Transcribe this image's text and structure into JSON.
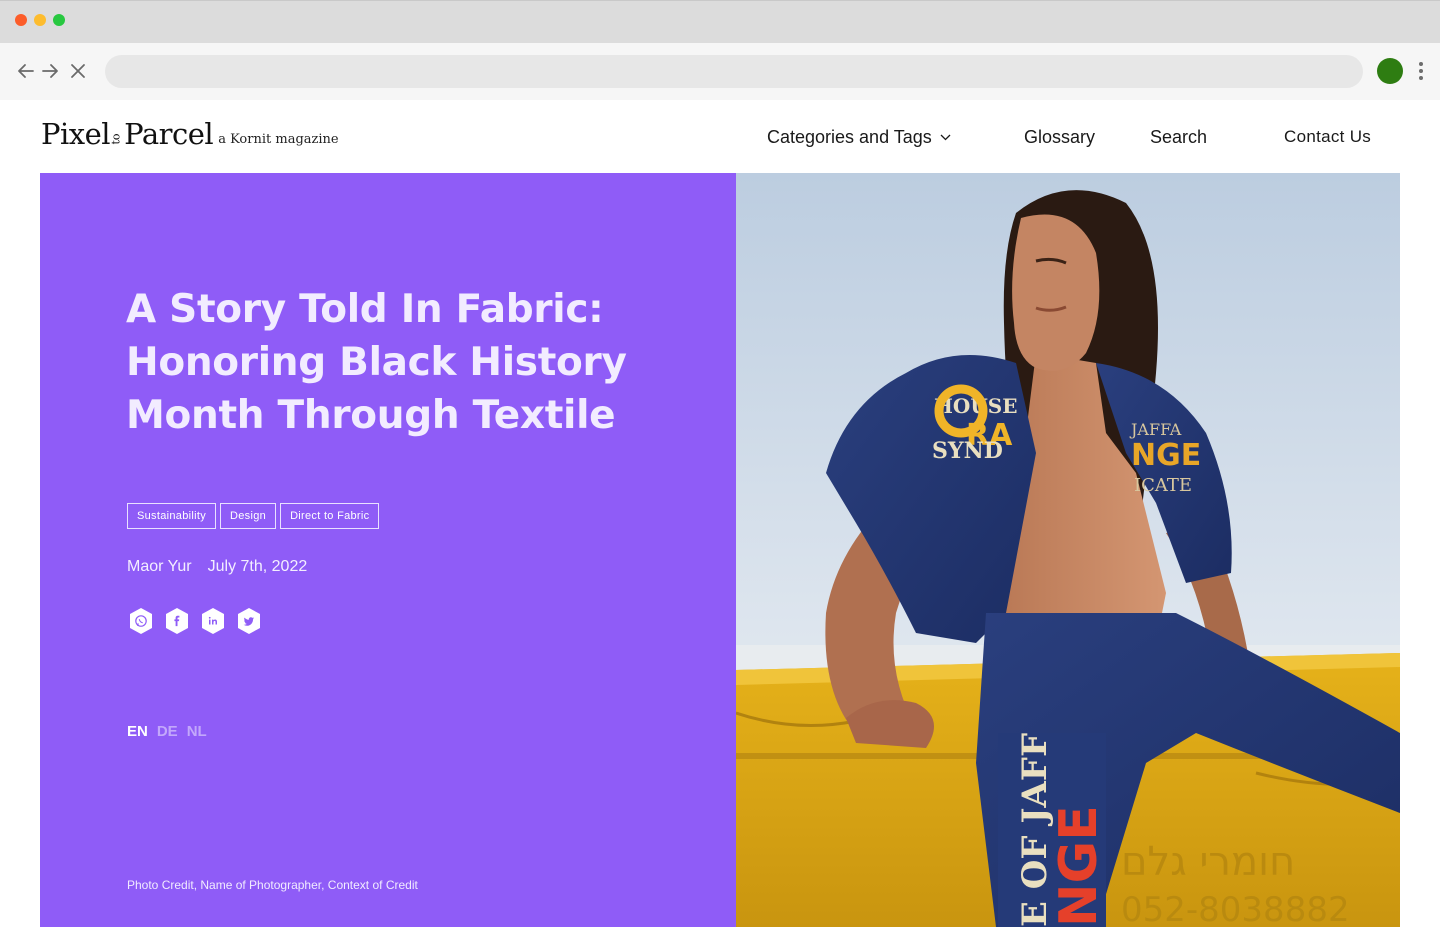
{
  "browser": {
    "traffic_lights": [
      "close",
      "minimize",
      "maximize"
    ],
    "colors": {
      "close": "#fc5d2a",
      "minimize": "#fdbc2e",
      "maximize": "#28c840",
      "profile": "#2e7d12"
    },
    "address": ""
  },
  "site": {
    "logo": {
      "word1": "Pixel",
      "connector": "to",
      "word2": "Parcel",
      "tagline": "a Kornit magazine"
    },
    "nav": {
      "categories": "Categories and Tags",
      "glossary": "Glossary",
      "search": "Search",
      "contact": "Contact Us"
    }
  },
  "hero": {
    "accent_color": "#8f5cf7",
    "title": "A Story Told In Fabric: Honoring Black History Month Through Textile",
    "tags": [
      "Sustainability",
      "Design",
      "Direct to Fabric"
    ],
    "author": "Maor Yur",
    "date": "July 7th, 2022",
    "share_icons": [
      "whatsapp-icon",
      "facebook-icon",
      "linkedin-icon",
      "twitter-icon"
    ],
    "languages": {
      "active": "EN",
      "others": [
        "DE",
        "NL"
      ]
    },
    "photo_credit": "Photo Credit, Name of Photographer, Context of Credit",
    "photo_text": {
      "shirt_left_1": "HOUSE",
      "shirt_left_2": "RA",
      "shirt_left_3": "SYND",
      "shirt_right_1": "JAFFA",
      "shirt_right_2": "NGE",
      "shirt_right_3": "ICATE",
      "pants_1": "E OF JAFF",
      "pants_2": "NGE",
      "container_1": "חומרי גלם",
      "container_2": "052-8038882"
    }
  }
}
